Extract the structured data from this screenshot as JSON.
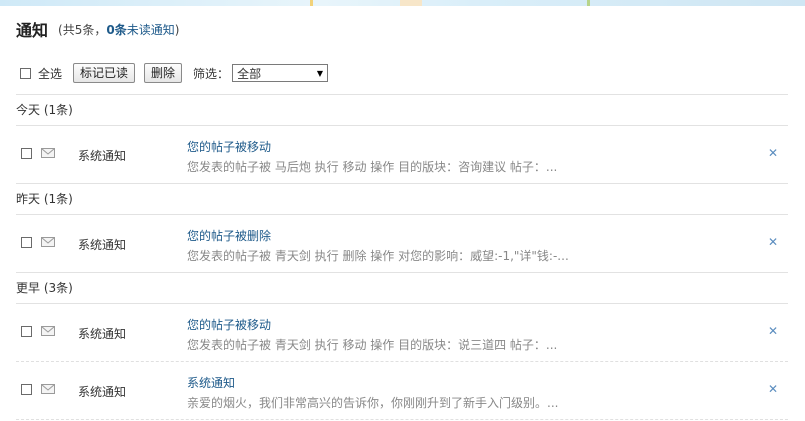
{
  "header": {
    "title": "通知",
    "summary_prefix": "(共5条，",
    "unread_count": "0条",
    "unread_label": "未读通知",
    "summary_suffix": ")"
  },
  "toolbar": {
    "select_all_label": "全选",
    "mark_read_label": "标记已读",
    "delete_label": "删除",
    "filter_label": "筛选：",
    "filter_value": "全部"
  },
  "groups": [
    {
      "label": "今天 (1条)",
      "items": [
        {
          "sender": "系统通知",
          "subject": "您的帖子被移动",
          "excerpt": "您发表的帖子被 马后炮 执行 移动 操作 目的版块：咨询建议 帖子：..."
        }
      ]
    },
    {
      "label": "昨天 (1条)",
      "items": [
        {
          "sender": "系统通知",
          "subject": "您的帖子被删除",
          "excerpt": "您发表的帖子被 青天剑 执行 删除 操作 对您的影响：威望:-1,\"详\"钱:-..."
        }
      ]
    },
    {
      "label": "更早 (3条)",
      "items": [
        {
          "sender": "系统通知",
          "subject": "您的帖子被移动",
          "excerpt": "您发表的帖子被 青天剑 执行 移动 操作 目的版块：说三道四 帖子：..."
        },
        {
          "sender": "系统通知",
          "subject": "系统通知",
          "excerpt": "亲爱的烟火，我们非常高兴的告诉你，你刚刚升到了新手入门级别。..."
        }
      ]
    }
  ],
  "colors": {
    "link": "#1e5a8a",
    "close": "#5b8dbf",
    "excerpt": "#888888"
  },
  "icons": {
    "row_icon": "envelope-icon",
    "close_icon": "close-icon",
    "dropdown_icon": "chevron-down-icon"
  }
}
